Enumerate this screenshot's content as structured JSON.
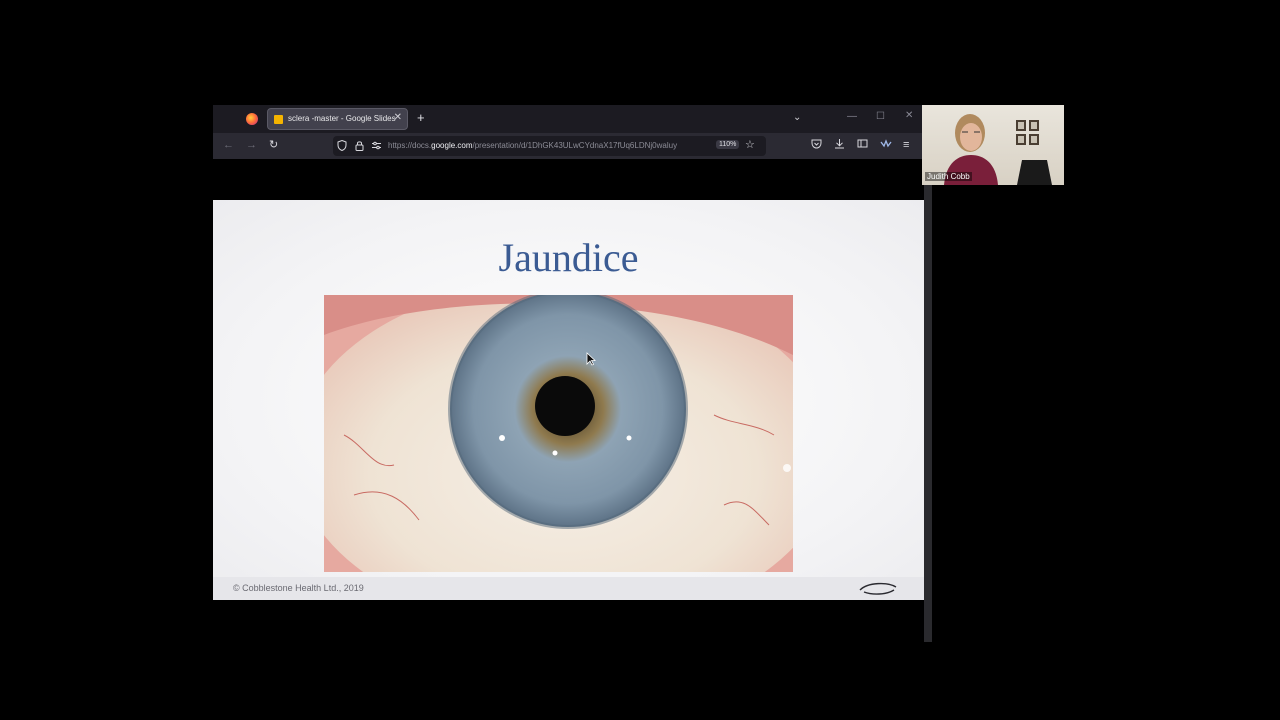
{
  "browser": {
    "tab_title": "sclera -master - Google Slides",
    "tab_close": "✕",
    "new_tab": "+",
    "tab_list": "⌄",
    "url_prefix": "https://docs.",
    "url_domain": "google.com",
    "url_path": "/presentation/d/1DhGK43ULwCYdnaX17fUq6LDNj0waluy",
    "zoom": "110%",
    "window_controls": {
      "minimize": "—",
      "maximize": "☐",
      "close": "✕"
    }
  },
  "nav": {
    "back": "←",
    "forward": "→",
    "reload": "↻",
    "star": "☆",
    "menu": "≡"
  },
  "slide": {
    "title": "Jaundice",
    "footer": "© Cobblestone Health Ltd., 2019"
  },
  "webcam": {
    "name": "Judith Cobb"
  },
  "colors": {
    "title": "#3b5b93",
    "tab_bg": "#42414d",
    "toolbar_bg": "#2b2a33"
  }
}
